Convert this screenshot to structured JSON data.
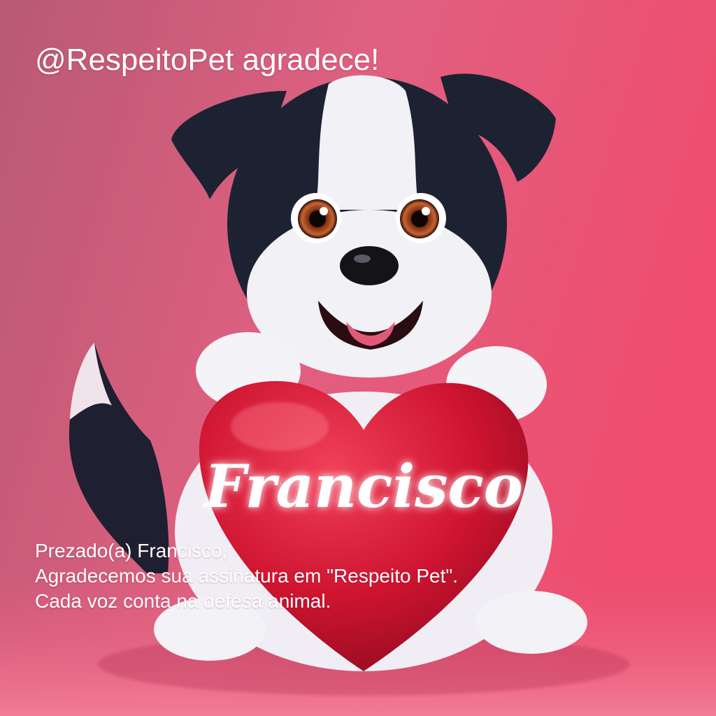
{
  "header": {
    "title": "@RespeitoPet agradece!"
  },
  "heart": {
    "name": "Francisco"
  },
  "message": {
    "greeting": "Prezado(a) Francisco,",
    "line1": "Agradecemos sua assinatura em \"Respeito Pet\".",
    "line2": "Cada voz conta na defesa animal."
  },
  "illustration": {
    "subject": "puppy-holding-heart-icon",
    "colors": {
      "bg_light": "#c9566e",
      "bg_pink": "#ef4d6f",
      "heart": "#d3122e",
      "fur_dark": "#1d2233",
      "fur_light": "#f1f1f6"
    }
  }
}
